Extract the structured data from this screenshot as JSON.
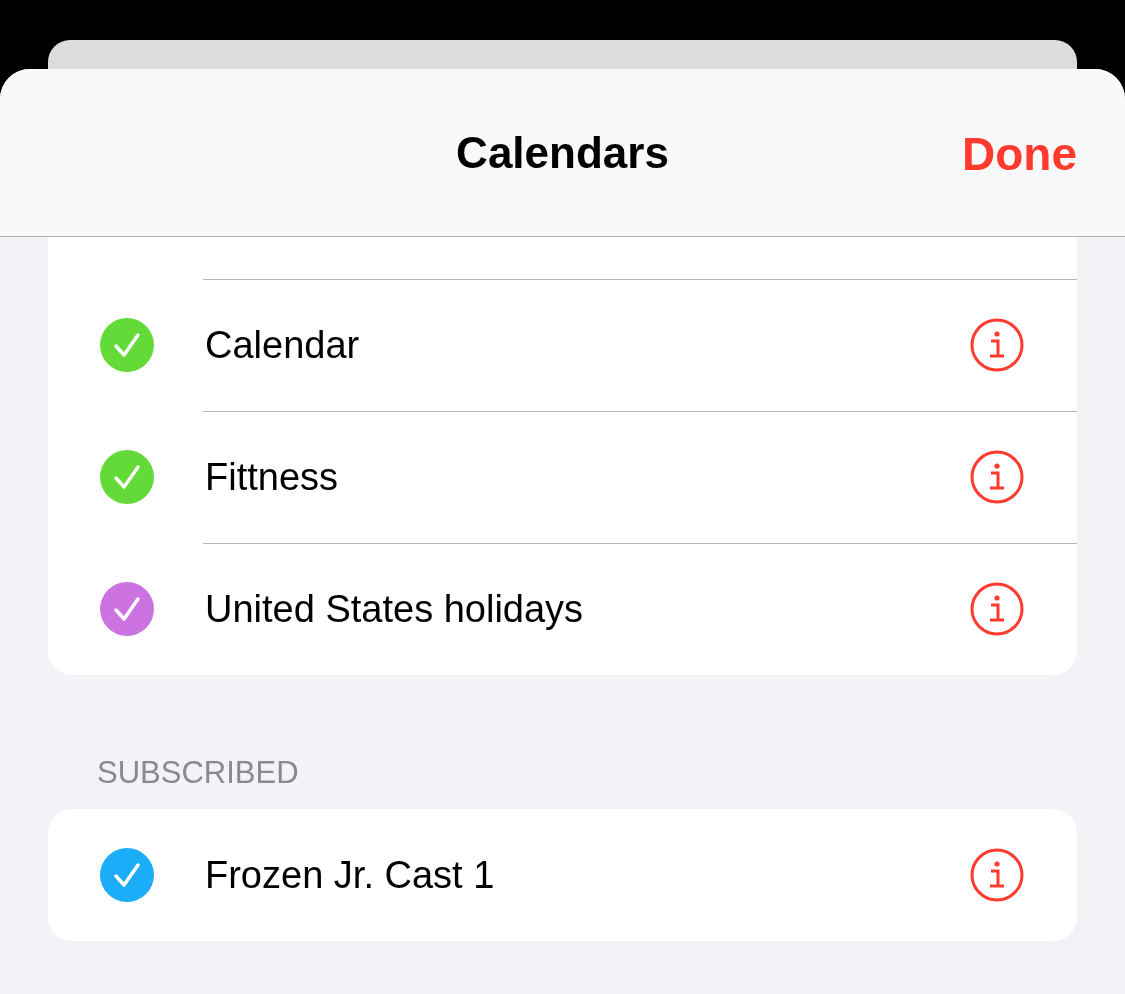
{
  "header": {
    "title": "Calendars",
    "done": "Done"
  },
  "sections": [
    {
      "items": [
        {
          "name": "Calendar",
          "color": "#63da38",
          "checked": true
        },
        {
          "name": "Fittness",
          "color": "#63da38",
          "checked": true
        },
        {
          "name": "United States holidays",
          "color": "#cc73e1",
          "checked": true
        }
      ]
    },
    {
      "title": "SUBSCRIBED",
      "items": [
        {
          "name": "Frozen Jr. Cast 1",
          "color": "#1badf8",
          "checked": true
        }
      ]
    }
  ]
}
